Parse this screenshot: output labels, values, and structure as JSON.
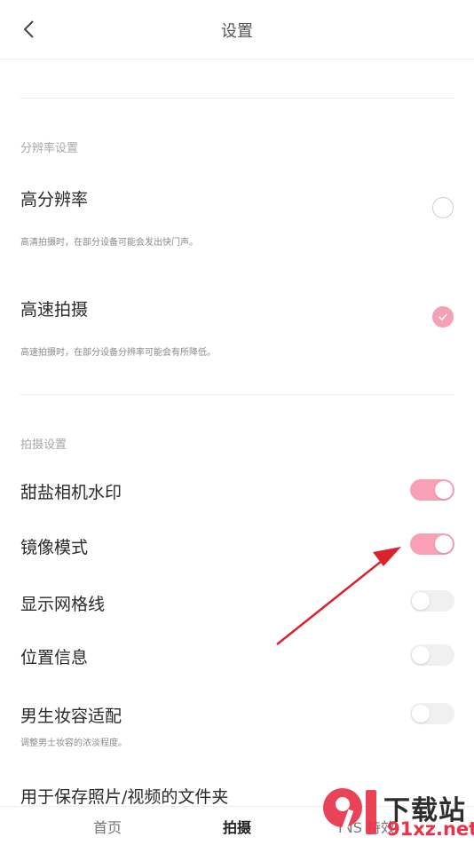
{
  "header": {
    "title": "设置"
  },
  "resolution_section": {
    "label": "分辨率设置",
    "high_resolution": {
      "title": "高分辨率",
      "desc": "高清拍摄时，在部分设备可能会发出快门声。",
      "checked": false
    },
    "high_speed": {
      "title": "高速拍摄",
      "desc": "高速拍摄时，在部分设备分辨率可能会有所降低。",
      "checked": true
    }
  },
  "shooting_section": {
    "label": "拍摄设置",
    "watermark": {
      "title": "甜盐相机水印",
      "on": true
    },
    "mirror": {
      "title": "镜像模式",
      "on": true
    },
    "grid": {
      "title": "显示网格线",
      "on": false
    },
    "location": {
      "title": "位置信息",
      "on": false
    },
    "male_makeup": {
      "title": "男生妆容适配",
      "desc": "调整男士妆容的浓淡程度。",
      "on": false
    },
    "save_folder": {
      "title": "用于保存照片/视频的文件夹"
    }
  },
  "tabbar": {
    "home": "首页",
    "shoot": "拍摄",
    "ins": "INS 特效"
  },
  "watermark": {
    "logo_text": "9I",
    "cn_text": "下载站",
    "url_text": "91xz.net"
  },
  "colors": {
    "accent_pink": "#f8a0b6",
    "annotation_arrow": "#d9232d",
    "watermark_red": "#e8334a"
  }
}
